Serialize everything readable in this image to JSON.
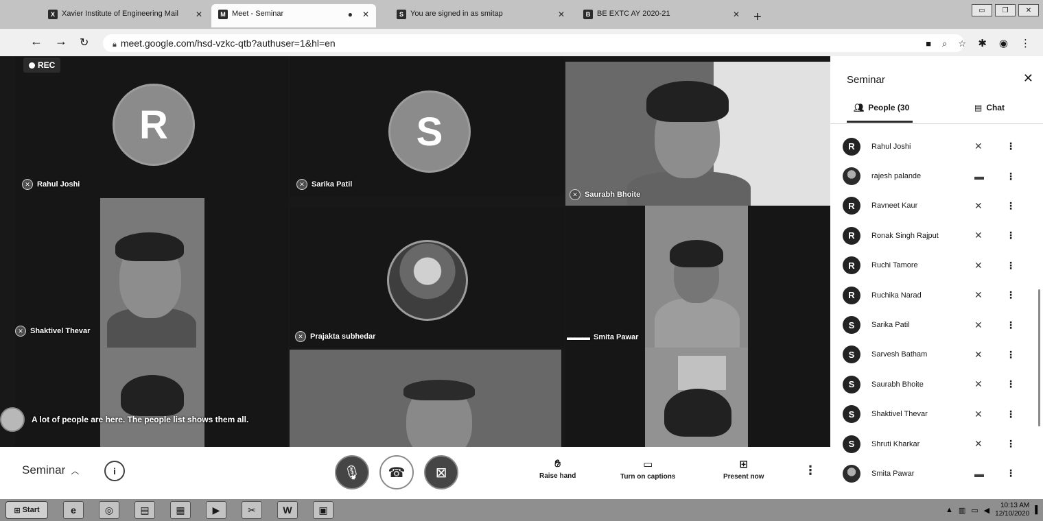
{
  "browser": {
    "tabs": [
      {
        "favicon": "X",
        "title": "Xavier Institute of Engineering Mail"
      },
      {
        "favicon": "M",
        "title": "Meet - Seminar"
      },
      {
        "favicon": "●",
        "title": ""
      },
      {
        "favicon": "S",
        "title": "You are signed in as smitap"
      },
      {
        "favicon": "B",
        "title": "BE EXTC AY 2020-21"
      }
    ],
    "url": "meet.google.com/hsd-vzkc-qtb?authuser=1&hl=en"
  },
  "meet": {
    "rec_label": "REC",
    "tiles": {
      "rahul": {
        "initial": "R",
        "name": "Rahul Joshi"
      },
      "sarika": {
        "initial": "S",
        "name": "Sarika Patil"
      },
      "saurabh": {
        "name": "Saurabh Bhoite"
      },
      "shaktivel": {
        "name": "Shaktivel Thevar"
      },
      "prajakta": {
        "name": "Prajakta subhedar"
      },
      "smita": {
        "name": "Smita Pawar"
      }
    },
    "toast": "A lot of people are here. The people list shows them all.",
    "controls": {
      "meeting_name": "Seminar",
      "raise_hand": "Raise hand",
      "captions": "Turn on captions",
      "present": "Present now"
    }
  },
  "panel": {
    "title": "Seminar",
    "people_tab": "People (30",
    "chat_tab": "Chat",
    "people": [
      {
        "initial": "R",
        "name": "Rahul Joshi",
        "mic": "muted"
      },
      {
        "initial": "",
        "name": "rajesh palande",
        "mic": "speaking"
      },
      {
        "initial": "R",
        "name": "Ravneet Kaur",
        "mic": "muted"
      },
      {
        "initial": "R",
        "name": "Ronak Singh Rajput",
        "mic": "muted"
      },
      {
        "initial": "R",
        "name": "Ruchi Tamore",
        "mic": "muted"
      },
      {
        "initial": "R",
        "name": "Ruchika Narad",
        "mic": "muted"
      },
      {
        "initial": "S",
        "name": "Sarika Patil",
        "mic": "muted"
      },
      {
        "initial": "S",
        "name": "Sarvesh Batham",
        "mic": "muted"
      },
      {
        "initial": "S",
        "name": "Saurabh Bhoite",
        "mic": "muted"
      },
      {
        "initial": "S",
        "name": "Shaktivel Thevar",
        "mic": "muted"
      },
      {
        "initial": "S",
        "name": "Shruti Kharkar",
        "mic": "muted"
      },
      {
        "initial": "",
        "name": "Smita Pawar",
        "mic": "speaking"
      }
    ]
  },
  "taskbar": {
    "start": "Start",
    "word_icon": "W",
    "time": "10:13 AM",
    "date": "12/10/2020"
  }
}
